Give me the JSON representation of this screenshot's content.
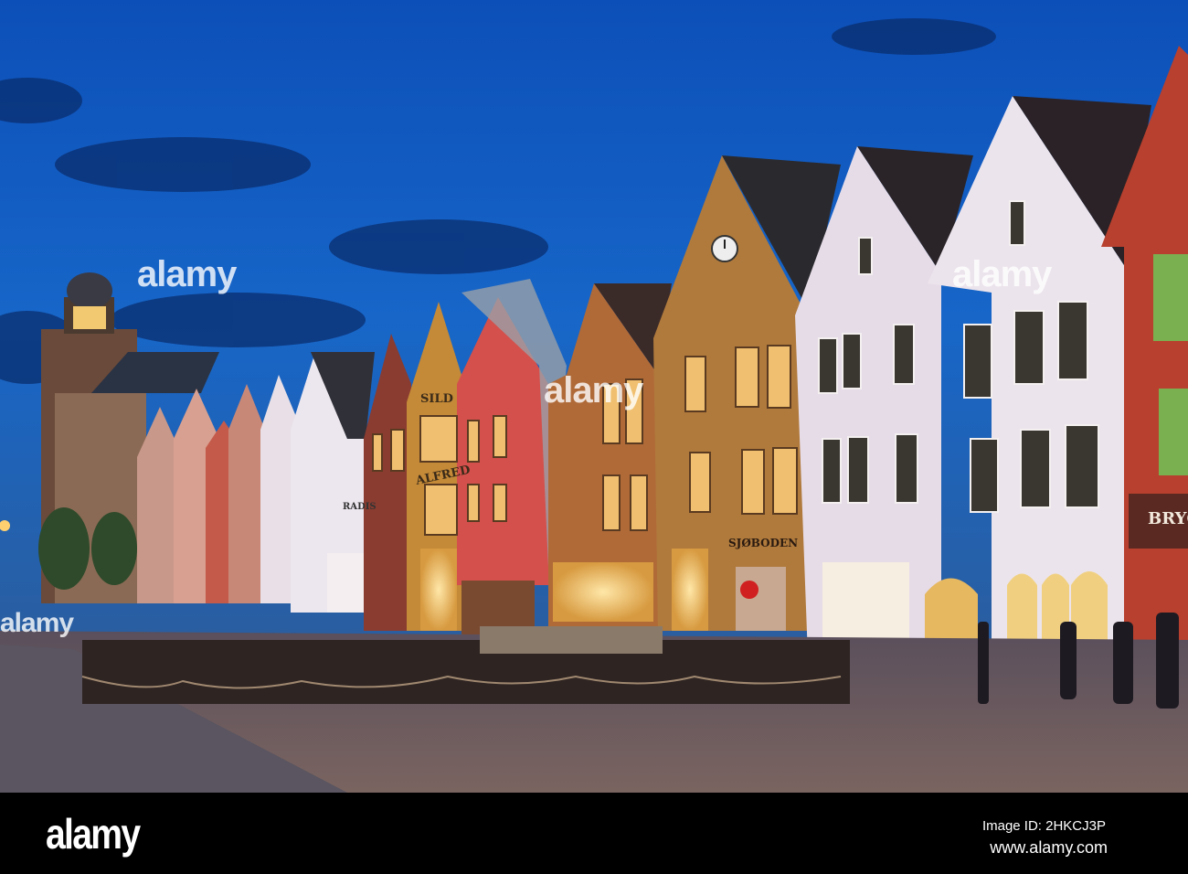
{
  "photo": {
    "signs": {
      "sild": "SILD",
      "alfred": "ALFRED",
      "radis": "RADIS",
      "sjoboden": "SJØBODEN",
      "bryg": "BRYG"
    }
  },
  "watermark": {
    "text": "alamy"
  },
  "footer": {
    "logo": "alamy",
    "image_id": "Image ID: 2HKCJ3P",
    "url": "www.alamy.com"
  }
}
